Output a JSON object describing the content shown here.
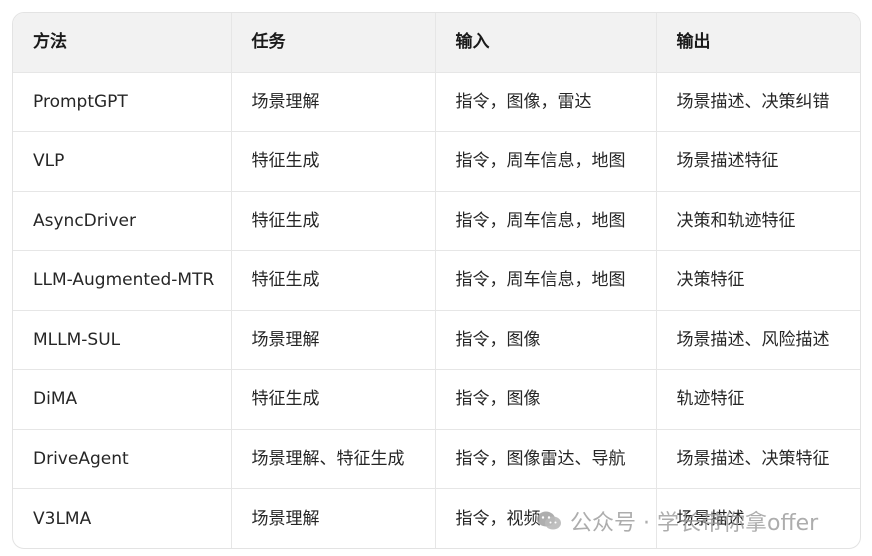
{
  "table": {
    "headers": [
      "方法",
      "任务",
      "输入",
      "输出"
    ],
    "rows": [
      [
        "PromptGPT",
        "场景理解",
        "指令，图像，雷达",
        "场景描述、决策纠错"
      ],
      [
        "VLP",
        "特征生成",
        "指令，周车信息，地图",
        "场景描述特征"
      ],
      [
        "AsyncDriver",
        "特征生成",
        "指令，周车信息，地图",
        "决策和轨迹特征"
      ],
      [
        "LLM-Augmented-MTR",
        "特征生成",
        "指令，周车信息，地图",
        "决策特征"
      ],
      [
        "MLLM-SUL",
        "场景理解",
        "指令，图像",
        "场景描述、风险描述"
      ],
      [
        "DiMA",
        "特征生成",
        "指令，图像",
        "轨迹特征"
      ],
      [
        "DriveAgent",
        "场景理解、特征生成",
        "指令，图像雷达、导航",
        "场景描述、决策特征"
      ],
      [
        "V3LMA",
        "场景理解",
        "指令，视频",
        "场景描述"
      ]
    ]
  },
  "watermark": {
    "icon": "wechat-logo-icon",
    "text": "公众号 · 学长带你拿offer"
  }
}
